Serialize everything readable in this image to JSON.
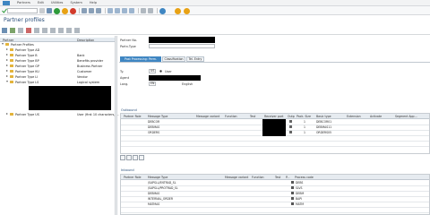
{
  "menu": {
    "items": [
      "Partners",
      "Edit",
      "Utilities",
      "System",
      "Help"
    ]
  },
  "window": {
    "title": "Partner profiles"
  },
  "tree": {
    "columns": [
      "Partner",
      "Description"
    ],
    "root": "Partner Profiles",
    "items": [
      {
        "label": "Partner Type AD",
        "desc": ""
      },
      {
        "label": "Partner Type B",
        "desc": "Bank"
      },
      {
        "label": "Partner Type BP",
        "desc": "Benefits provider"
      },
      {
        "label": "Partner Type GP",
        "desc": "Business Partner"
      },
      {
        "label": "Partner Type KU",
        "desc": "Customer"
      },
      {
        "label": "Partner Type LI",
        "desc": "Vendor"
      },
      {
        "label": "Partner Type LS",
        "desc": "Logical system"
      },
      {
        "label": "Partner Type US",
        "desc": "User (first 10 characters, ..."
      }
    ]
  },
  "form": {
    "partner_no_label": "Partner No.",
    "partn_type_label": "Partn.Type",
    "tabs": [
      "Post Processing: Perm. Agents",
      "Classification",
      "Tel. Entry"
    ],
    "ty_label": "Ty.",
    "ty_value": "US",
    "user_label": "User",
    "agent_label": "Agent",
    "lang_label": "Lang.",
    "lang_value": "EN",
    "lang_text": "English"
  },
  "outbound": {
    "title": "Outbound",
    "columns": [
      "Partner Role",
      "Message Type",
      "Message variant",
      "Function",
      "Test",
      "Receiver port",
      "Outp",
      "Pack. Size",
      "Basic type",
      "Extension",
      "Activate",
      "Segment App..."
    ],
    "rows": [
      {
        "msg": "DEBCOR",
        "basic": "DEBCOR01",
        "size": "1"
      },
      {
        "msg": "DEBMAS",
        "basic": "DEBMAS11",
        "size": "1"
      },
      {
        "msg": "ORDERS",
        "basic": "ORDERS05",
        "size": "1"
      }
    ]
  },
  "inbound": {
    "title": "Inbound",
    "columns": [
      "Partner Role",
      "Message Type",
      "Message variant",
      "Function",
      "Test",
      "P...",
      "Process code"
    ],
    "rows": [
      {
        "msg": "/SAPSLL/ENTRAD_SL",
        "code": "DEBS"
      },
      {
        "msg": "/SAPSLL/PROTRAD_SL",
        "code": "SLVS"
      },
      {
        "msg": "DEBMAS",
        "code": "DEBM"
      },
      {
        "msg": "INTERNAL_ORDER",
        "code": "BAPI"
      },
      {
        "msg": "MATMAS",
        "code": "MATM"
      }
    ]
  },
  "colors": {
    "accent": "#3f86c2",
    "title": "#2b4f7a",
    "folder": "#e3b33a",
    "ok": "#2e9b3a",
    "cancel": "#d23b2b",
    "warn": "#e8a215"
  }
}
